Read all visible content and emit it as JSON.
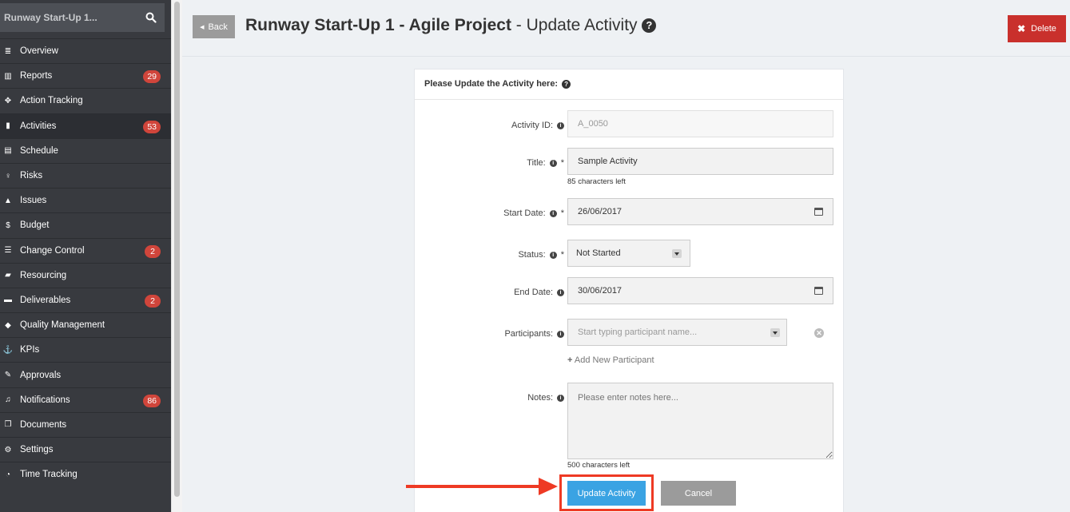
{
  "sidebar": {
    "project": "Runway Start-Up 1...",
    "items": [
      {
        "label": "Overview",
        "icon": "list-icon",
        "badge": ""
      },
      {
        "label": "Reports",
        "icon": "bar-chart-icon",
        "badge": "29"
      },
      {
        "label": "Action Tracking",
        "icon": "crosshair-icon",
        "badge": ""
      },
      {
        "label": "Activities",
        "icon": "bookmark-icon",
        "badge": "53"
      },
      {
        "label": "Schedule",
        "icon": "calendar-icon",
        "badge": ""
      },
      {
        "label": "Risks",
        "icon": "lightbulb-icon",
        "badge": ""
      },
      {
        "label": "Issues",
        "icon": "warning-icon",
        "badge": ""
      },
      {
        "label": "Budget",
        "icon": "dollar-icon",
        "badge": ""
      },
      {
        "label": "Change Control",
        "icon": "tasks-icon",
        "badge": "2"
      },
      {
        "label": "Resourcing",
        "icon": "folder-open-icon",
        "badge": ""
      },
      {
        "label": "Deliverables",
        "icon": "truck-icon",
        "badge": "2"
      },
      {
        "label": "Quality Management",
        "icon": "tag-icon",
        "badge": ""
      },
      {
        "label": "KPIs",
        "icon": "anchor-icon",
        "badge": ""
      },
      {
        "label": "Approvals",
        "icon": "pencil-icon",
        "badge": ""
      },
      {
        "label": "Notifications",
        "icon": "bell-icon",
        "badge": "86"
      },
      {
        "label": "Documents",
        "icon": "documents-icon",
        "badge": ""
      },
      {
        "label": "Settings",
        "icon": "cogs-icon",
        "badge": ""
      },
      {
        "label": "Time Tracking",
        "icon": "clock-icon",
        "badge": ""
      }
    ]
  },
  "header": {
    "back_label": "Back",
    "title_bold": "Runway Start-Up 1 - Agile Project",
    "title_rest": "- Update Activity",
    "help_symbol": "?",
    "delete_label": "Delete"
  },
  "form": {
    "heading": "Please Update the Activity here:",
    "activity_id": {
      "label": "Activity ID:",
      "value": "A_0050"
    },
    "title": {
      "label": "Title:",
      "value": "Sample Activity",
      "hint": "85 characters left"
    },
    "start_date": {
      "label": "Start Date:",
      "value": "26/06/2017"
    },
    "status": {
      "label": "Status:",
      "value": "Not Started"
    },
    "end_date": {
      "label": "End Date:",
      "value": "30/06/2017"
    },
    "participants": {
      "label": "Participants:",
      "placeholder": "Start typing participant name...",
      "add_label": "Add New Participant"
    },
    "notes": {
      "label": "Notes:",
      "placeholder": "Please enter notes here...",
      "hint": "500 characters left"
    },
    "update_label": "Update Activity",
    "cancel_label": "Cancel",
    "required_mark": "*"
  },
  "colors": {
    "primary": "#3aa3e3",
    "danger": "#c9302c",
    "badge": "#d0453b",
    "sidebar_bg": "#383a3f",
    "annotation": "#ee3a24"
  }
}
